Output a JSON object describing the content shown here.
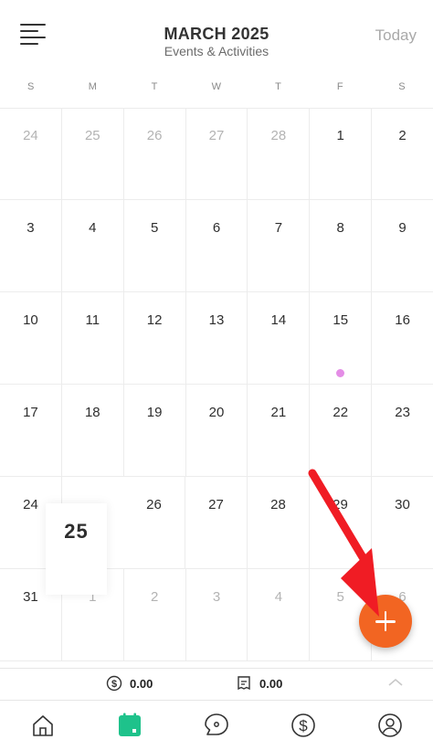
{
  "header": {
    "month_title": "MARCH 2025",
    "subtitle": "Events & Activities",
    "today_label": "Today"
  },
  "weekdays": [
    "S",
    "M",
    "T",
    "W",
    "T",
    "F",
    "S"
  ],
  "calendar": {
    "weeks": [
      [
        {
          "d": "24",
          "muted": true
        },
        {
          "d": "25",
          "muted": true
        },
        {
          "d": "26",
          "muted": true
        },
        {
          "d": "27",
          "muted": true
        },
        {
          "d": "28",
          "muted": true
        },
        {
          "d": "1"
        },
        {
          "d": "2"
        }
      ],
      [
        {
          "d": "3"
        },
        {
          "d": "4"
        },
        {
          "d": "5"
        },
        {
          "d": "6"
        },
        {
          "d": "7"
        },
        {
          "d": "8"
        },
        {
          "d": "9"
        }
      ],
      [
        {
          "d": "10"
        },
        {
          "d": "11"
        },
        {
          "d": "12"
        },
        {
          "d": "13"
        },
        {
          "d": "14"
        },
        {
          "d": "15",
          "event": true
        },
        {
          "d": "16"
        }
      ],
      [
        {
          "d": "17"
        },
        {
          "d": "18"
        },
        {
          "d": "19"
        },
        {
          "d": "20"
        },
        {
          "d": "21"
        },
        {
          "d": "22"
        },
        {
          "d": "23"
        }
      ],
      [
        {
          "d": "24"
        },
        {
          "d": "25",
          "today": true
        },
        {
          "d": "26"
        },
        {
          "d": "27"
        },
        {
          "d": "28"
        },
        {
          "d": "29"
        },
        {
          "d": "30"
        }
      ],
      [
        {
          "d": "31"
        },
        {
          "d": "1",
          "muted": true
        },
        {
          "d": "2",
          "muted": true
        },
        {
          "d": "3",
          "muted": true
        },
        {
          "d": "4",
          "muted": true
        },
        {
          "d": "5",
          "muted": true
        },
        {
          "d": "6",
          "muted": true
        }
      ]
    ],
    "event_dot_color": "#e48de6"
  },
  "summary": {
    "money_value": "0.00",
    "receipt_value": "0.00"
  },
  "fab": {
    "icon": "plus-icon",
    "color": "#f26522"
  },
  "annotation": {
    "icon": "red-arrow",
    "color": "#f01c24"
  },
  "tabbar": {
    "items": [
      {
        "icon": "home-icon"
      },
      {
        "icon": "calendar-icon",
        "active": true,
        "color": "#1ec28b"
      },
      {
        "icon": "chat-icon"
      },
      {
        "icon": "dollar-icon"
      },
      {
        "icon": "profile-icon"
      }
    ]
  }
}
